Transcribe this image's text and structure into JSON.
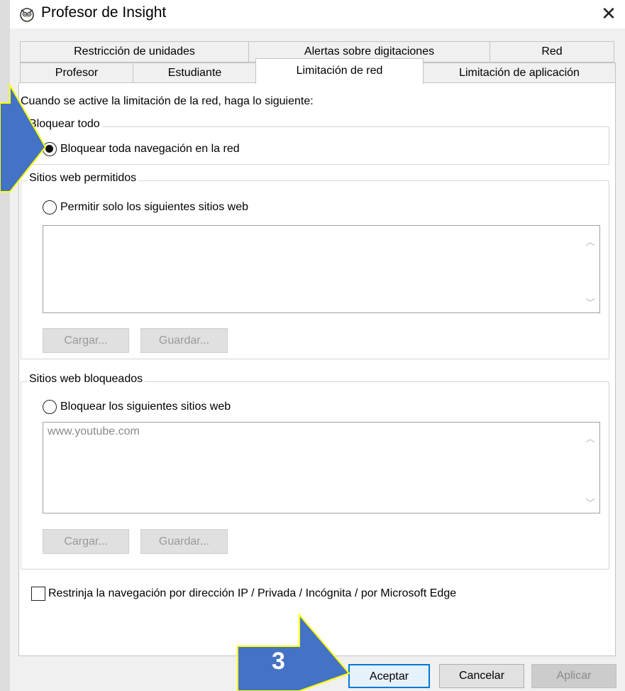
{
  "window": {
    "title": "Profesor de Insight",
    "close_glyph": "✕"
  },
  "tabs": {
    "row1": [
      "Restricción de unidades",
      "Alertas sobre digitaciones",
      "Red"
    ],
    "row2": [
      "Profesor",
      "Estudiante",
      "Limitación de red",
      "Limitación de aplicación"
    ],
    "active": "Limitación de red"
  },
  "intro": "Cuando se active la limitación de la red, haga lo siguiente:",
  "block_all": {
    "legend": "Bloquear todo",
    "option": "Bloquear toda navegación en la red",
    "selected": true
  },
  "allowed": {
    "legend": "Sitios web permitidos",
    "option": "Permitir solo los siguientes sitios web",
    "selected": false,
    "list_text": "",
    "load": "Cargar...",
    "save": "Guardar..."
  },
  "blocked": {
    "legend": "Sitios web bloqueados",
    "option": "Bloquear los siguientes sitios web",
    "selected": false,
    "list_text": "www.youtube.com",
    "load": "Cargar...",
    "save": "Guardar..."
  },
  "restrict": {
    "label": "Restrinja la navegación por dirección IP / Privada / Incógnita / por Microsoft Edge",
    "checked": false
  },
  "footer": {
    "ok": "Aceptar",
    "cancel": "Cancelar",
    "apply": "Aplicar"
  },
  "annotation": {
    "step": "3",
    "color": "#4472c4",
    "outline": "#ffff00"
  },
  "icons": {
    "title": "owl-icon",
    "scroll_up": "chevron-up-icon",
    "scroll_down": "chevron-down-icon"
  }
}
